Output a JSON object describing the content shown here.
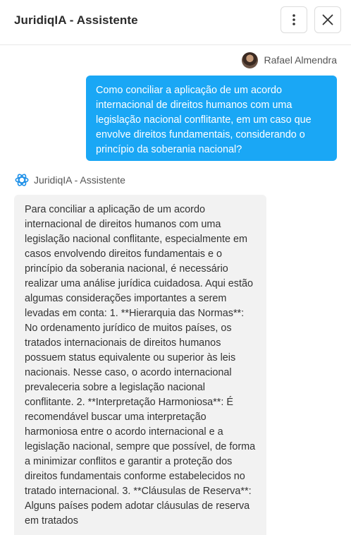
{
  "header": {
    "title": "JuridiqIA - Assistente",
    "more_icon": "vertical-dots-icon",
    "close_icon": "close-icon"
  },
  "messages": {
    "user": {
      "name": "Rafael Almendra",
      "text": "Como conciliar a aplicação de um acordo internacional de direitos humanos com uma legislação nacional conflitante, em um caso que envolve direitos fundamentais, considerando o princípio da soberania nacional?"
    },
    "assistant": {
      "name": "JuridiqIA - Assistente",
      "text": "Para conciliar a aplicação de um acordo internacional de direitos humanos com uma legislação nacional conflitante, especialmente em casos envolvendo direitos fundamentais e o princípio da soberania nacional, é necessário realizar uma análise jurídica cuidadosa. Aqui estão algumas considerações importantes a serem levadas em conta: 1. **Hierarquia das Normas**: No ordenamento jurídico de muitos países, os tratados internacionais de direitos humanos possuem status equivalente ou superior às leis nacionais. Nesse caso, o acordo internacional prevaleceria sobre a legislação nacional conflitante. 2. **Interpretação Harmoniosa**: É recomendável buscar uma interpretação harmoniosa entre o acordo internacional e a legislação nacional, sempre que possível, de forma a minimizar conflitos e garantir a proteção dos direitos fundamentais conforme estabelecidos no tratado internacional. 3. **Cláusulas de Reserva**: Alguns países podem adotar cláusulas de reserva em tratados"
    }
  },
  "colors": {
    "user_bubble": "#1aa7f5",
    "assistant_bubble": "#f2f2f2"
  }
}
